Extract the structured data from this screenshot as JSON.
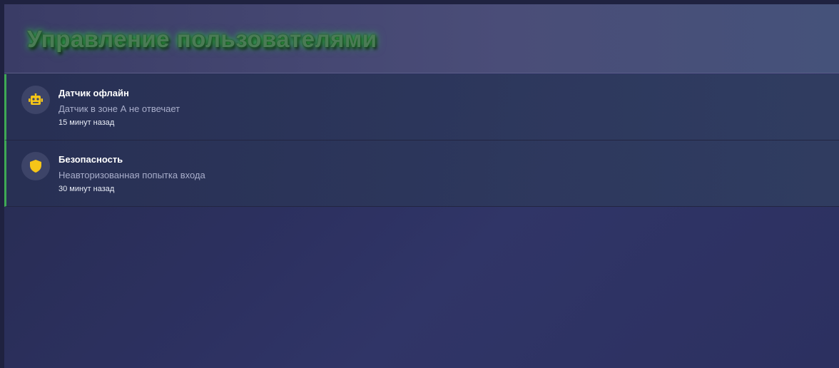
{
  "header": {
    "title": "Управление пользователями"
  },
  "notifications": [
    {
      "icon": "robot-icon",
      "title": "Датчик офлайн",
      "message": "Датчик в зоне А не отвечает",
      "time": "15 минут назад"
    },
    {
      "icon": "shield-icon",
      "title": "Безопасность",
      "message": "Неавторизованная попытка входа",
      "time": "30 минут назад"
    }
  ],
  "colors": {
    "accent_border": "#3fa955",
    "icon_color": "#f5c518",
    "title_glow": "#2ecc40"
  }
}
